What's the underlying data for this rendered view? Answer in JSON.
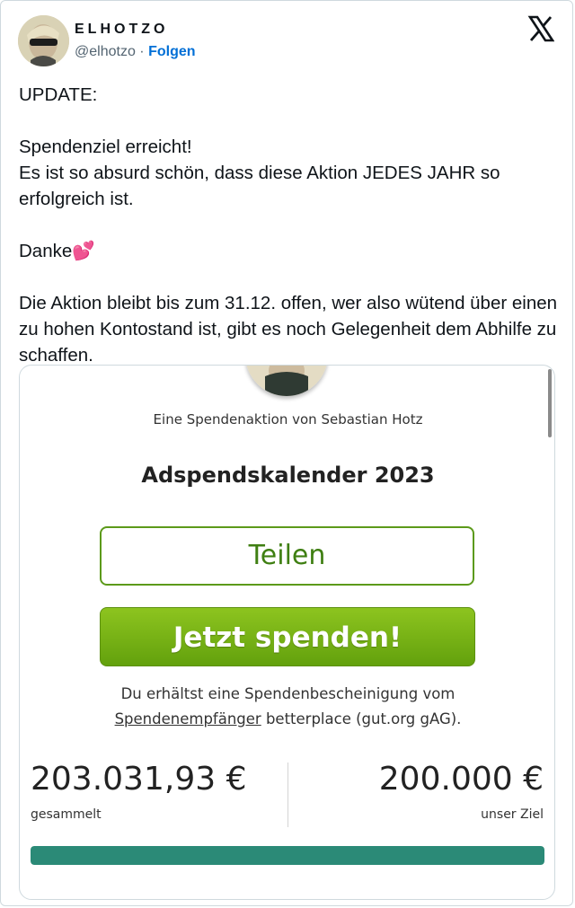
{
  "author": {
    "display_name": "ELHOTZO",
    "handle": "@elhotzo",
    "separator": "·",
    "follow_label": "Folgen"
  },
  "platform": {
    "logo_icon": "x-logo-icon"
  },
  "tweet": {
    "line_update": "UPDATE:",
    "line_goal": "Spendenziel erreicht!",
    "line_absurd": "Es ist so absurd schön, dass diese Aktion JEDES JAHR so erfolgreich ist.",
    "line_thanks": "Danke",
    "thanks_emoji": "💕",
    "line_open": "Die Aktion bleibt bis zum 31.12. offen, wer also wütend über einen zu hohen Kontostand ist, gibt es noch Gelegenheit dem Abhilfe zu schaffen."
  },
  "campaign": {
    "byline": "Eine Spendenaktion von Sebastian Hotz",
    "title": "Adspendskalender 2023",
    "share_label": "Teilen",
    "donate_label": "Jetzt spenden!",
    "receipt_text_1": "Du erhältst eine Spendenbescheinigung vom",
    "receipt_link": "Spendenempfänger",
    "receipt_text_2": " betterplace (gut.org gAG).",
    "collected_amount": "203.031,93 €",
    "collected_label": "gesammelt",
    "goal_amount": "200.000 €",
    "goal_label": "unser Ziel",
    "progress_fraction": 1.0,
    "progress_color": "#2b8a77",
    "accent_green": "#5c9a1a"
  }
}
